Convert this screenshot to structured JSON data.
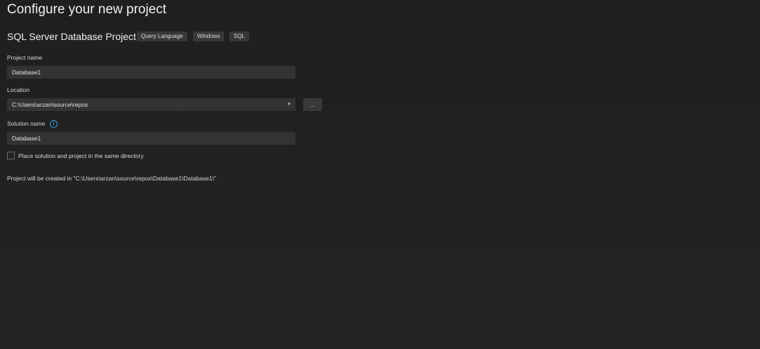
{
  "title": "Configure your new project",
  "project_type": "SQL Server Database Project",
  "tags": [
    "Query Language",
    "Windows",
    "SQL"
  ],
  "project_name": {
    "label": "Project name",
    "value": "Database1"
  },
  "location": {
    "label": "Location",
    "value": "C:\\Users\\arzan\\source\\repos",
    "browse_label": "..."
  },
  "solution_name": {
    "label": "Solution name",
    "value": "Database1"
  },
  "same_directory": {
    "label": "Place solution and project in the same directory",
    "checked": false
  },
  "summary": "Project will be created in \"C:\\Users\\arzan\\source\\repos\\Database1\\Database1\\\""
}
